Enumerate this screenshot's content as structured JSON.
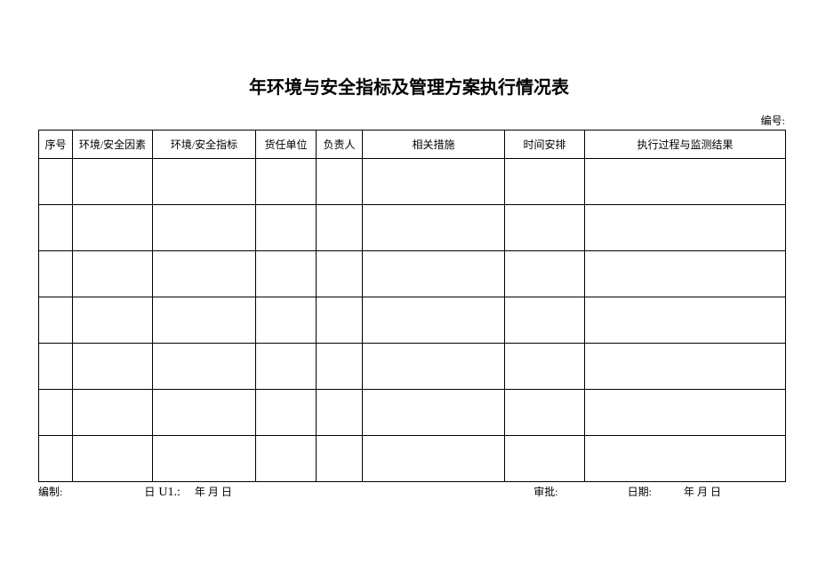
{
  "title": "年环境与安全指标及管理方案执行情况表",
  "docNumberLabel": "编号:",
  "headers": {
    "seq": "序号",
    "factor": "环境/安全因素",
    "indicator": "环境/安全指标",
    "unit": "货任单位",
    "person": "负责人",
    "measure": "相关措施",
    "time": "时间安排",
    "result": "执行过程与监测结果"
  },
  "rows": [
    {
      "seq": "",
      "factor": "",
      "indicator": "",
      "unit": "",
      "person": "",
      "measure": "",
      "time": "",
      "result": ""
    },
    {
      "seq": "",
      "factor": "",
      "indicator": "",
      "unit": "",
      "person": "",
      "measure": "",
      "time": "",
      "result": ""
    },
    {
      "seq": "",
      "factor": "",
      "indicator": "",
      "unit": "",
      "person": "",
      "measure": "",
      "time": "",
      "result": ""
    },
    {
      "seq": "",
      "factor": "",
      "indicator": "",
      "unit": "",
      "person": "",
      "measure": "",
      "time": "",
      "result": ""
    },
    {
      "seq": "",
      "factor": "",
      "indicator": "",
      "unit": "",
      "person": "",
      "measure": "",
      "time": "",
      "result": ""
    },
    {
      "seq": "",
      "factor": "",
      "indicator": "",
      "unit": "",
      "person": "",
      "measure": "",
      "time": "",
      "result": ""
    },
    {
      "seq": "",
      "factor": "",
      "indicator": "",
      "unit": "",
      "person": "",
      "measure": "",
      "time": "",
      "result": ""
    }
  ],
  "footer": {
    "prepLabel": "编制:",
    "ri": "日",
    "u1": "U1.:",
    "nyri1": "年 月 日",
    "approveLabel": "审批:",
    "dateLabel": "日期:",
    "nyri2": "年 月 日"
  }
}
